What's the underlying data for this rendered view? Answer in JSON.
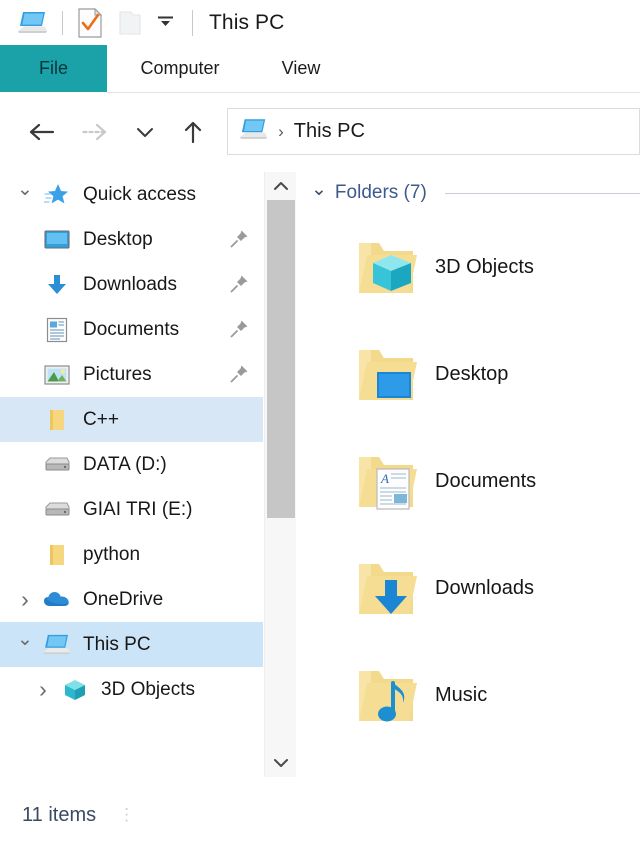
{
  "window": {
    "title": "This PC",
    "quick_access_toolbar": [
      {
        "icon": "this-pc-icon",
        "name": "this-pc"
      },
      {
        "icon": "properties-checkmark-icon",
        "name": "properties"
      },
      {
        "icon": "new-folder-icon",
        "name": "new-folder",
        "disabled": true
      },
      {
        "icon": "chevron-down-icon",
        "name": "customize-toolbar"
      }
    ]
  },
  "ribbon": {
    "tabs": [
      {
        "label": "File",
        "active": true
      },
      {
        "label": "Computer",
        "active": false
      },
      {
        "label": "View",
        "active": false
      }
    ],
    "file_tab_color": "#1ba1a8"
  },
  "navigation": {
    "back": {
      "label": "Back",
      "enabled": true
    },
    "forward": {
      "label": "Forward",
      "enabled": false
    },
    "recent": {
      "label": "Recent locations",
      "enabled": true
    },
    "up": {
      "label": "Up",
      "enabled": true
    },
    "address": {
      "icon": "this-pc-icon",
      "separator": "›",
      "crumb": "This PC"
    }
  },
  "sidebar": {
    "items": [
      {
        "label": "Quick access",
        "icon": "star-icon",
        "chevron": "down",
        "indent": 0,
        "state": "none",
        "pinned": false
      },
      {
        "label": "Desktop",
        "icon": "desktop-icon",
        "chevron": "none",
        "indent": 1,
        "state": "none",
        "pinned": true
      },
      {
        "label": "Downloads",
        "icon": "downloads-icon",
        "chevron": "none",
        "indent": 1,
        "state": "none",
        "pinned": true
      },
      {
        "label": "Documents",
        "icon": "documents-icon",
        "chevron": "none",
        "indent": 1,
        "state": "none",
        "pinned": true
      },
      {
        "label": "Pictures",
        "icon": "pictures-icon",
        "chevron": "none",
        "indent": 1,
        "state": "none",
        "pinned": true
      },
      {
        "label": "C++",
        "icon": "folder-icon",
        "chevron": "none",
        "indent": 1,
        "state": "hover",
        "pinned": false
      },
      {
        "label": "DATA (D:)",
        "icon": "drive-icon",
        "chevron": "none",
        "indent": 1,
        "state": "none",
        "pinned": false
      },
      {
        "label": "GIAI TRI (E:)",
        "icon": "drive-icon",
        "chevron": "none",
        "indent": 1,
        "state": "none",
        "pinned": false
      },
      {
        "label": "python",
        "icon": "folder-icon",
        "chevron": "none",
        "indent": 1,
        "state": "none",
        "pinned": false
      },
      {
        "label": "OneDrive",
        "icon": "cloud-icon",
        "chevron": "right",
        "indent": 0,
        "state": "none",
        "pinned": false
      },
      {
        "label": "This PC",
        "icon": "this-pc-icon",
        "chevron": "down",
        "indent": 0,
        "state": "selected",
        "pinned": false
      },
      {
        "label": "3D Objects",
        "icon": "cube-icon",
        "chevron": "right",
        "indent": 1,
        "state": "none",
        "pinned": false
      }
    ],
    "selection_color": "#cce4f7",
    "hover_color": "#d8e7f5"
  },
  "scrollbar": {
    "up_arrow": "chevron-up-icon",
    "down_arrow": "chevron-down-icon",
    "thumb_color": "#c6c6c6"
  },
  "content": {
    "group": {
      "label": "Folders (7)",
      "expanded": true
    },
    "items": [
      {
        "label": "3D Objects",
        "icon": "folder-3d-objects-icon"
      },
      {
        "label": "Desktop",
        "icon": "folder-desktop-icon"
      },
      {
        "label": "Documents",
        "icon": "folder-documents-icon"
      },
      {
        "label": "Downloads",
        "icon": "folder-downloads-icon"
      },
      {
        "label": "Music",
        "icon": "folder-music-icon"
      }
    ]
  },
  "statusbar": {
    "item_count": "11 items"
  }
}
